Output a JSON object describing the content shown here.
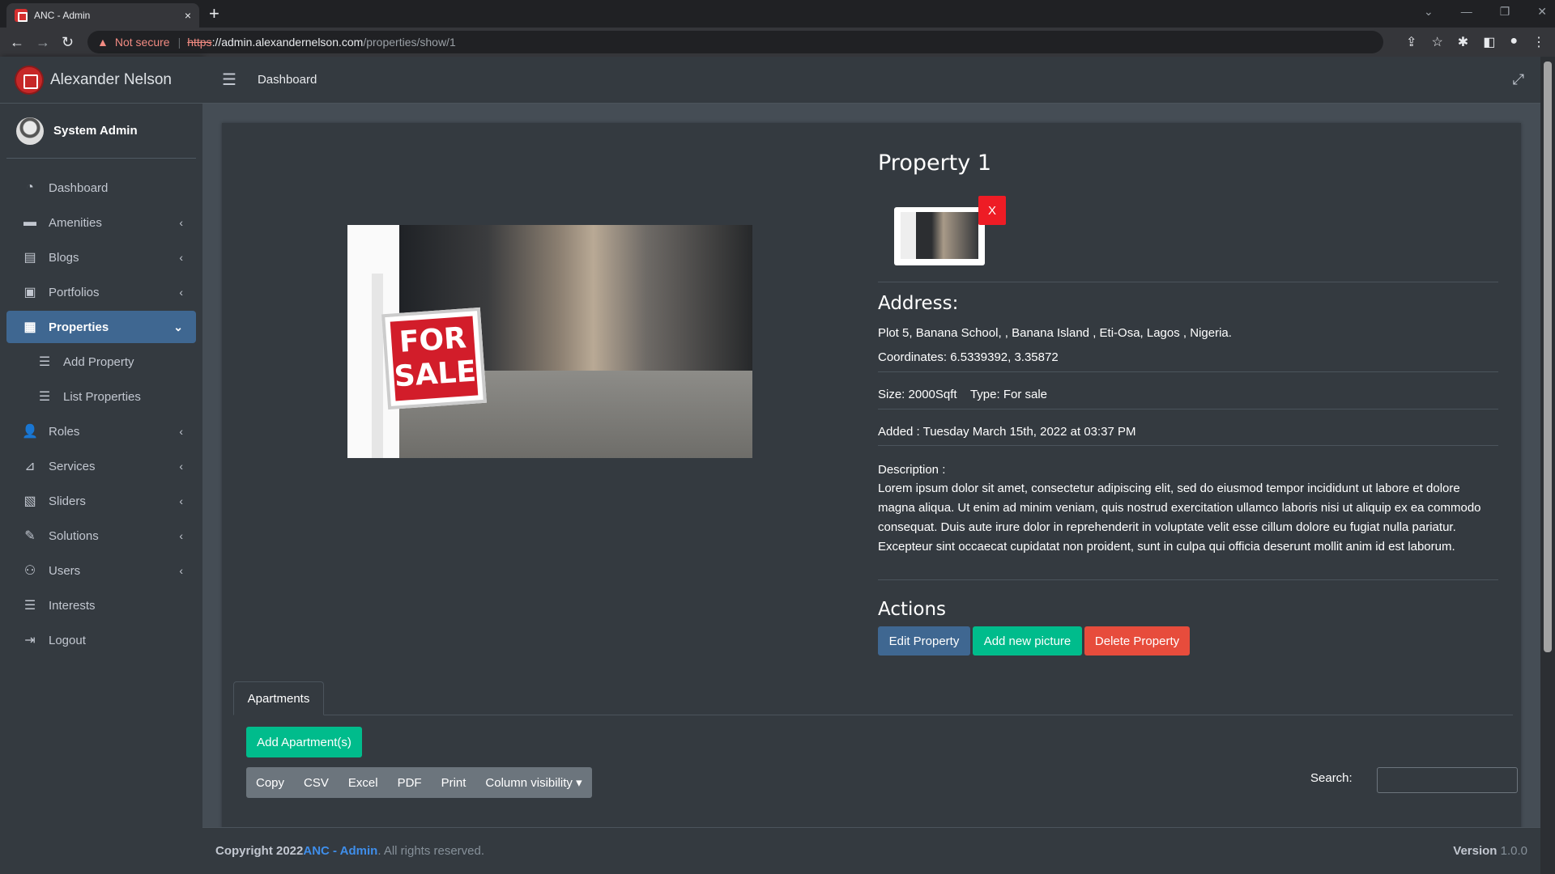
{
  "browser": {
    "tab_title": "ANC - Admin",
    "tab_close": "×",
    "new_tab": "+",
    "not_secure": "Not secure",
    "url_scheme": "https",
    "url_host": "://admin.alexandernelson.com",
    "url_path": "/properties/show/1"
  },
  "sidebar": {
    "brand": "Alexander Nelson",
    "user": "System Admin",
    "items": [
      {
        "label": "Dashboard",
        "icon": "dashboard-icon",
        "glyph": "◔",
        "chevron": false,
        "active": false,
        "sub": false
      },
      {
        "label": "Amenities",
        "icon": "bed-icon",
        "glyph": "▬",
        "chevron": true,
        "active": false,
        "sub": false
      },
      {
        "label": "Blogs",
        "icon": "book-icon",
        "glyph": "▤",
        "chevron": true,
        "active": false,
        "sub": false
      },
      {
        "label": "Portfolios",
        "icon": "briefcase-icon",
        "glyph": "▣",
        "chevron": true,
        "active": false,
        "sub": false
      },
      {
        "label": "Properties",
        "icon": "building-icon",
        "glyph": "▦",
        "chevron": true,
        "active": true,
        "sub": false
      },
      {
        "label": "Add Property",
        "icon": "list-icon",
        "glyph": "☰",
        "chevron": false,
        "active": false,
        "sub": true
      },
      {
        "label": "List Properties",
        "icon": "list-icon",
        "glyph": "☰",
        "chevron": false,
        "active": false,
        "sub": true
      },
      {
        "label": "Roles",
        "icon": "user-cog-icon",
        "glyph": "👤",
        "chevron": true,
        "active": false,
        "sub": false
      },
      {
        "label": "Services",
        "icon": "satellite-dish-icon",
        "glyph": "⊿",
        "chevron": true,
        "active": false,
        "sub": false
      },
      {
        "label": "Sliders",
        "icon": "image-icon",
        "glyph": "▧",
        "chevron": true,
        "active": false,
        "sub": false
      },
      {
        "label": "Solutions",
        "icon": "edit-icon",
        "glyph": "✎",
        "chevron": true,
        "active": false,
        "sub": false
      },
      {
        "label": "Users",
        "icon": "users-icon",
        "glyph": "⚇",
        "chevron": true,
        "active": false,
        "sub": false
      },
      {
        "label": "Interests",
        "icon": "list-icon",
        "glyph": "☰",
        "chevron": false,
        "active": false,
        "sub": false
      },
      {
        "label": "Logout",
        "icon": "sign-out-icon",
        "glyph": "⇥",
        "chevron": false,
        "active": false,
        "sub": false
      }
    ]
  },
  "topnav": {
    "title": "Dashboard"
  },
  "property": {
    "title": "Property 1",
    "thumb_delete": "X",
    "sign_text_line1": "FOR",
    "sign_text_line2": "SALE",
    "address_heading": "Address:",
    "address": "Plot 5, Banana School, , Banana Island , Eti-Osa, Lagos , Nigeria.",
    "coordinates": "Coordinates: 6.5339392, 3.35872",
    "size_type": "Size: 2000Sqft    Type: For sale",
    "added": "Added : Tuesday March 15th, 2022 at 03:37 PM",
    "description_label": "Description :",
    "description": "Lorem ipsum dolor sit amet, consectetur adipiscing elit, sed do eiusmod tempor incididunt ut labore et dolore magna aliqua. Ut enim ad minim veniam, quis nostrud exercitation ullamco laboris nisi ut aliquip ex ea commodo consequat. Duis aute irure dolor in reprehenderit in voluptate velit esse cillum dolore eu fugiat nulla pariatur. Excepteur sint occaecat cupidatat non proident, sunt in culpa qui officia deserunt mollit anim id est laborum.",
    "actions_heading": "Actions",
    "edit_label": "Edit Property",
    "add_picture_label": "Add new picture",
    "delete_label": "Delete Property"
  },
  "apartments": {
    "tab_label": "Apartments",
    "add_label": "Add Apartment(s)",
    "table_buttons": [
      "Copy",
      "CSV",
      "Excel",
      "PDF",
      "Print",
      "Column visibility ▾"
    ],
    "search_label": "Search:",
    "search_value": ""
  },
  "footer": {
    "copyright": "Copyright 2022 ",
    "brand": "ANC - Admin",
    "rights": ". All rights reserved.",
    "version_label": "Version",
    "version": " 1.0.0"
  }
}
